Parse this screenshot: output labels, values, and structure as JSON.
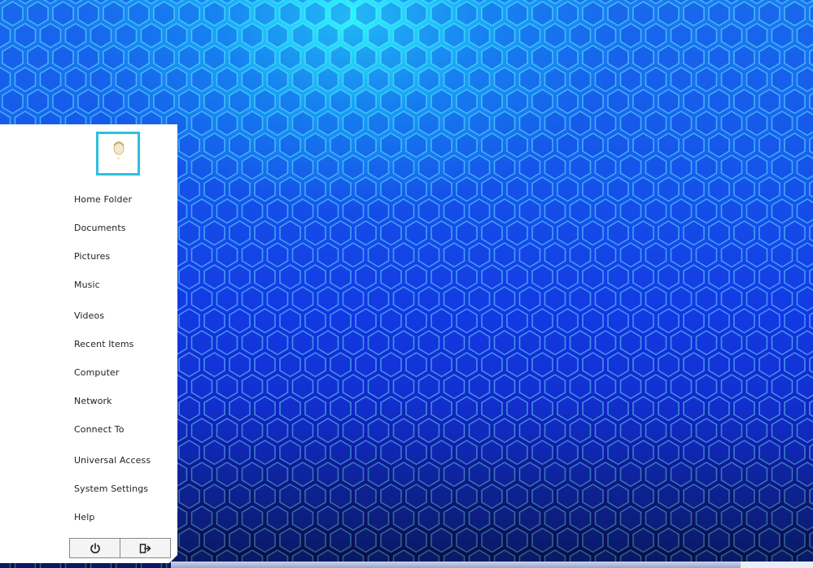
{
  "wallpaper": {
    "colors": {
      "top_glow": "#28ffff",
      "mid": "#1436f0",
      "bottom": "#0c1468",
      "hex_line": "#4fe0ff"
    }
  },
  "menu": {
    "avatar_icon": "user-avatar",
    "items": [
      {
        "label": "Home Folder"
      },
      {
        "label": "Documents"
      },
      {
        "label": "Pictures"
      },
      {
        "label": "Music"
      },
      {
        "label": "Videos"
      },
      {
        "label": "Recent Items"
      },
      {
        "label": "Computer"
      },
      {
        "label": "Network"
      },
      {
        "label": "Connect To"
      },
      {
        "label": "Universal Access"
      },
      {
        "label": "System Settings"
      },
      {
        "label": "Help"
      }
    ],
    "footer_buttons": [
      {
        "icon": "power-icon"
      },
      {
        "icon": "logout-icon"
      }
    ],
    "accent": "#2ec0e0"
  }
}
